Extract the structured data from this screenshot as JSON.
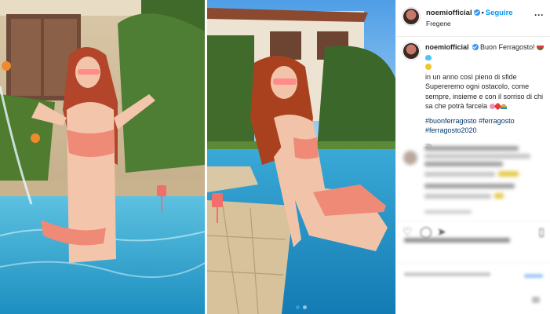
{
  "post": {
    "username": "noemiofficial",
    "follow_label": "Seguire",
    "location": "Fregene",
    "more_icon": "more-icon"
  },
  "caption": {
    "username": "noemiofficial",
    "line1": "Buon Ferragosto!",
    "line2": "in un anno così pieno di sfide",
    "line3": "Supereremo ogni ostacolo, come sempre, insieme e con il sorriso di chi sa che potrà farcela",
    "hashtags": [
      "#buonferragosto",
      "#ferragosto",
      "#ferragosto2020"
    ],
    "time_ago": "2h"
  },
  "icons": {
    "like": "heart-icon",
    "comment": "comment-icon",
    "share": "share-icon",
    "save": "bookmark-icon"
  },
  "colors": {
    "link": "#0095f6",
    "hashtag": "#00376b",
    "text": "#262626",
    "muted": "#8e8e8e",
    "carousel_active": "#3897f0"
  }
}
